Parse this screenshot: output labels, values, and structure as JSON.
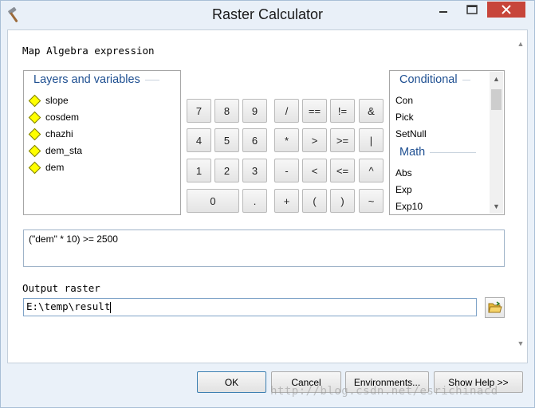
{
  "window": {
    "title": "Raster Calculator",
    "close_color": "#c7453a"
  },
  "expression_section": {
    "label": "Map Algebra expression",
    "expression_text": "(\"dem\"  * 10) >= 2500"
  },
  "layers_panel": {
    "header": "Layers and variables",
    "items": [
      "slope",
      "cosdem",
      "chazhi",
      "dem_sta",
      "dem"
    ]
  },
  "functions_panel": {
    "conditional_header": "Conditional",
    "conditional_items": [
      "Con",
      "Pick",
      "SetNull"
    ],
    "math_header": "Math",
    "math_items": [
      "Abs",
      "Exp",
      "Exp10"
    ]
  },
  "calculator": {
    "keys": [
      "7",
      "8",
      "9",
      "/",
      "==",
      "!=",
      "&",
      "4",
      "5",
      "6",
      "*",
      ">",
      ">=",
      "|",
      "1",
      "2",
      "3",
      "-",
      "<",
      "<=",
      "^",
      "0",
      ".",
      "+",
      "(",
      ")",
      "~"
    ]
  },
  "output_section": {
    "label": "Output raster",
    "value": "E:\\temp\\result"
  },
  "footer": {
    "ok": "OK",
    "cancel": "Cancel",
    "environments": "Environments...",
    "show_help": "Show Help >>"
  },
  "watermark": "http://blog.csdn.net/esrichinacd"
}
